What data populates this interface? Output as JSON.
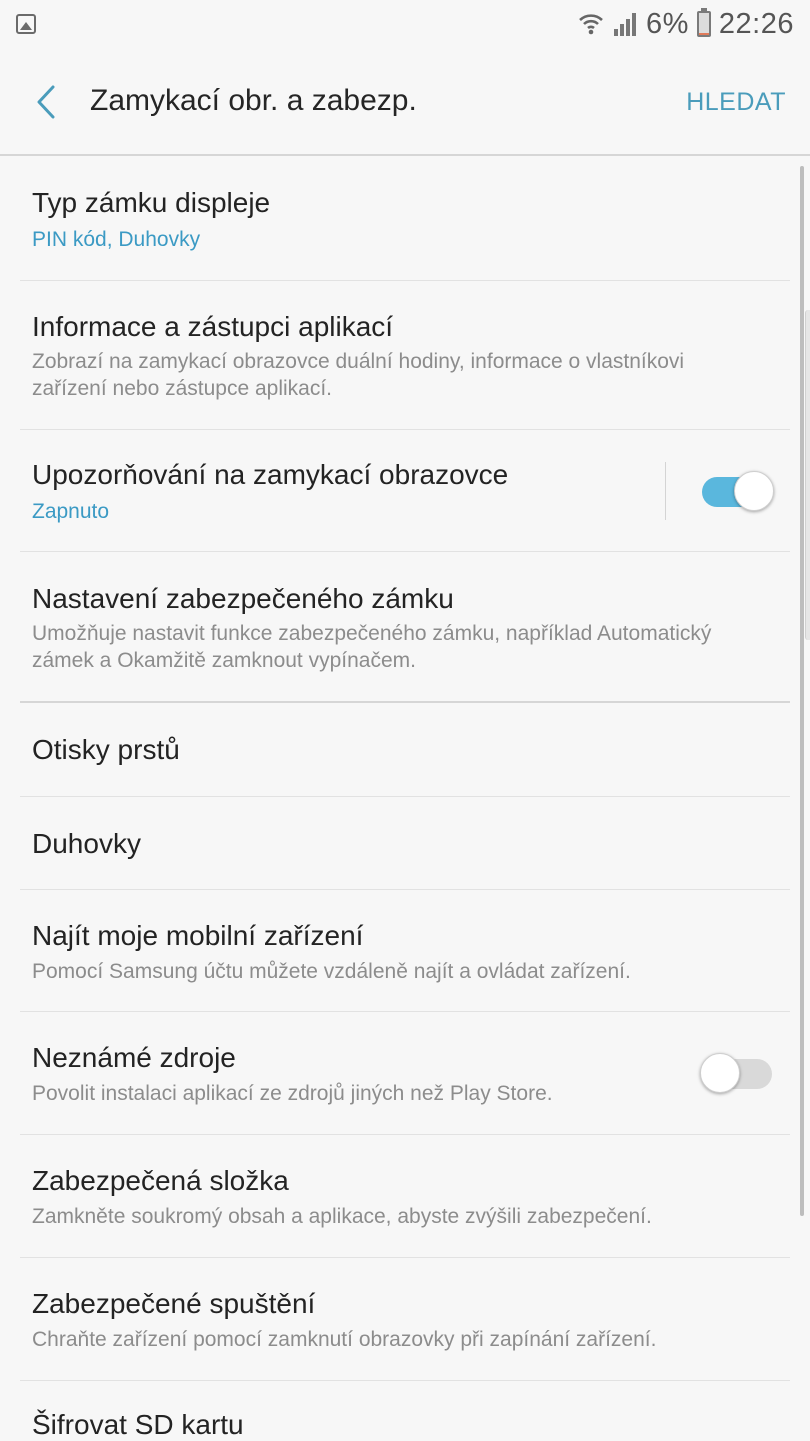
{
  "status_bar": {
    "battery_percent": "6%",
    "time": "22:26",
    "icons": [
      "gallery-notification-icon",
      "wifi-calling-icon",
      "signal-icon",
      "battery-icon"
    ]
  },
  "header": {
    "title": "Zamykací obr. a zabezp.",
    "search_label": "HLEDAT",
    "accent_color": "#4a9cbb"
  },
  "items": [
    {
      "title": "Typ zámku displeje",
      "subtitle": "PIN kód, Duhovky"
    },
    {
      "title": "Informace a zástupci aplikací",
      "subtitle": "Zobrazí na zamykací obrazovce duální hodiny, informace o vlastníkovi zařízení nebo zástupce aplikací."
    },
    {
      "title": "Upozorňování na zamykací obrazovce",
      "subtitle": "Zapnuto",
      "toggle": "on"
    },
    {
      "title": "Nastavení zabezpečeného zámku",
      "subtitle": "Umožňuje nastavit funkce zabezpečeného zámku, například Automatický zámek a Okamžitě zamknout vypínačem."
    },
    {
      "title": "Otisky prstů"
    },
    {
      "title": "Duhovky"
    },
    {
      "title": "Najít moje mobilní zařízení",
      "subtitle": "Pomocí Samsung účtu můžete vzdáleně najít a ovládat zařízení."
    },
    {
      "title": "Neznámé zdroje",
      "subtitle": "Povolit instalaci aplikací ze zdrojů jiných než Play Store.",
      "toggle": "off"
    },
    {
      "title": "Zabezpečená složka",
      "subtitle": "Zamkněte soukromý obsah a aplikace, abyste zvýšili zabezpečení."
    },
    {
      "title": "Zabezpečené spuštění",
      "subtitle": "Chraňte zařízení pomocí zamknutí obrazovky při zapínání zařízení."
    },
    {
      "title": "Šifrovat SD kartu"
    }
  ]
}
